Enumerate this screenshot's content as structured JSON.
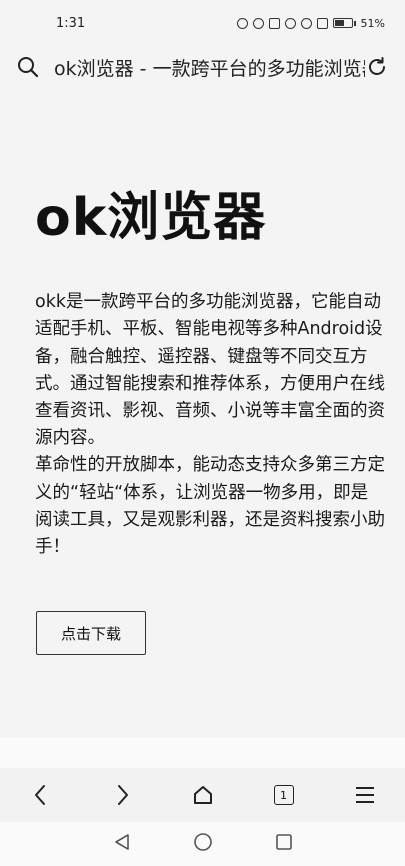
{
  "status": {
    "time": "1:31",
    "battery_percent": "51%",
    "battery_level": 0.51,
    "icons": [
      "hd-icon",
      "eye-icon",
      "vibrate-icon",
      "alarm-icon",
      "wifi-icon",
      "bluetooth-icon"
    ]
  },
  "address_bar": {
    "title": "ok浏览器 - 一款跨平台的多功能浏览器"
  },
  "page": {
    "headline": "ok浏览器",
    "paragraph1": "okk是一款跨平台的多功能浏览器，它能自动适配手机、平板、智能电视等多种Android设备，融合触控、遥控器、键盘等不同交互方式。通过智能搜索和推荐体系，方便用户在线查看资讯、影视、音频、小说等丰富全面的资源内容。",
    "paragraph2": "革命性的开放脚本，能动态支持众多第三方定义的“轻站“体系，让浏览器一物多用，即是阅读工具，又是观影利器，还是资料搜索小助手！",
    "download_label": "点击下载"
  },
  "browser_nav": {
    "tab_count": "1"
  },
  "colors": {
    "background": "#f4f4f4",
    "text": "#111111"
  }
}
